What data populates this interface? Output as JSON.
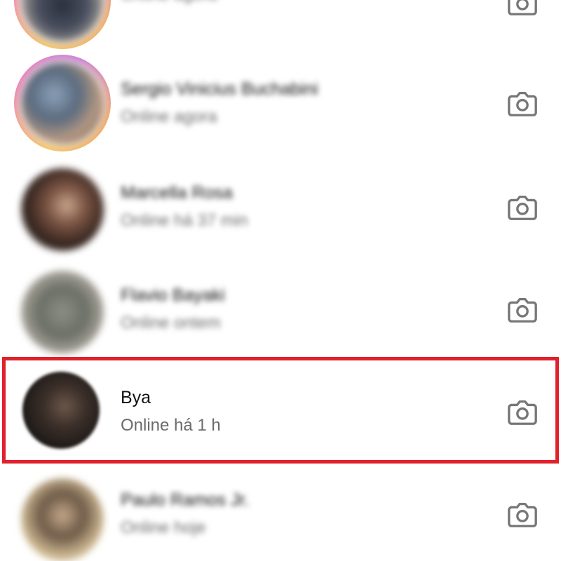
{
  "contacts": [
    {
      "name": "",
      "status": "Online agora"
    },
    {
      "name": "Sergio Vinicius Buchabini",
      "status": "Online agora"
    },
    {
      "name": "Marcella Rosa",
      "status": "Online há 37 min"
    },
    {
      "name": "Flavio Bayaki",
      "status": "Online ontem"
    },
    {
      "name": "Bya",
      "status": "Online há 1 h"
    },
    {
      "name": "Paulo Ramos Jr.",
      "status": "Online hoje"
    }
  ],
  "icons": {
    "camera": "camera-icon"
  },
  "colors": {
    "highlight": "#e0202a",
    "story_ring_start": "#f5c15a",
    "story_ring_end": "#c775d8",
    "status_text": "#6b6b6b"
  }
}
